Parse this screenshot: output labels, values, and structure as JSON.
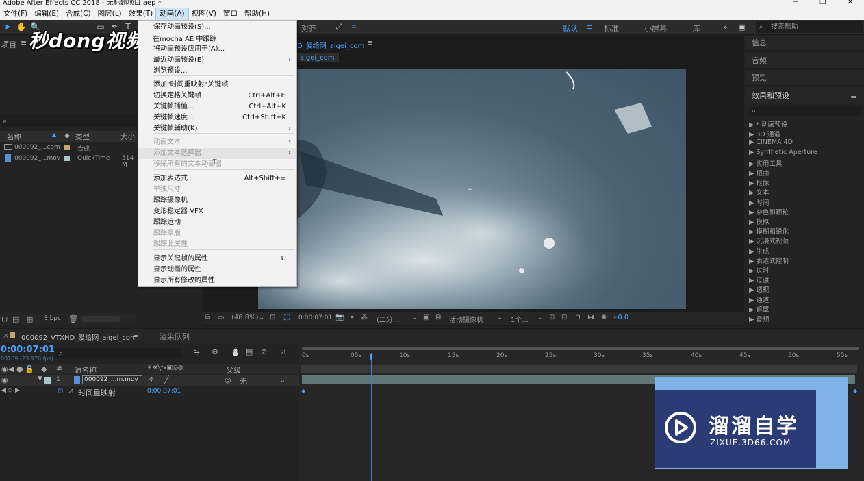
{
  "title": "Adobe After Effects CC 2018 - 无标题项目.aep *",
  "menubar": [
    "文件(F)",
    "编辑(E)",
    "合成(C)",
    "图层(L)",
    "效果(T)",
    "动画(A)",
    "视图(V)",
    "窗口",
    "帮助(H)"
  ],
  "menubar_active": "动画(A)",
  "toolbar": {
    "align_label": "对齐",
    "workspaces": [
      "默认",
      "标准",
      "小屏幕",
      "库"
    ],
    "search_placeholder": "搜索帮助"
  },
  "project": {
    "tab": "项目",
    "columns": [
      "名称",
      "类型",
      "大小"
    ],
    "items": [
      {
        "name": "000092_...com",
        "type": "合成",
        "size": ""
      },
      {
        "name": "000092_...mov",
        "type": "QuickTime",
        "size": "514 M"
      }
    ],
    "bpc": "8 bpc"
  },
  "viewer": {
    "comp_tab": "D_爱给网_aigei_com",
    "comp_crumb": "aigei_com",
    "zoom": "(48.8%)",
    "timecode": "0:00:07:01",
    "resolution": "(二分...",
    "camera": "活动摄像机",
    "views": "1个...",
    "exposure": "+0.0"
  },
  "dropdown": [
    {
      "label": "保存动画预设(S)...",
      "key": "",
      "arrow": false,
      "disabled": false
    },
    {
      "label": "将动画预设应用于(A)...",
      "key": "",
      "arrow": false,
      "disabled": false
    },
    {
      "label": "最近动画预设(E)",
      "key": "",
      "arrow": true,
      "disabled": false
    },
    {
      "label": "浏览预设...",
      "key": "",
      "arrow": false,
      "disabled": false
    },
    {
      "label": "添加\"时间重映射\"关键帧",
      "key": "",
      "arrow": false,
      "disabled": false
    },
    {
      "label": "切换定格关键帧",
      "key": "Ctrl+Alt+H",
      "arrow": false,
      "disabled": false
    },
    {
      "label": "关键帧插值...",
      "key": "Ctrl+Alt+K",
      "arrow": false,
      "disabled": false
    },
    {
      "label": "关键帧速度...",
      "key": "Ctrl+Shift+K",
      "arrow": false,
      "disabled": false
    },
    {
      "label": "关键帧辅助(K)",
      "key": "",
      "arrow": true,
      "disabled": false
    },
    {
      "label": "动画文本",
      "key": "",
      "arrow": true,
      "disabled": true
    },
    {
      "label": "添加文本选择器",
      "key": "",
      "arrow": true,
      "disabled": true
    },
    {
      "label": "移除所有的文本动画器",
      "key": "",
      "arrow": false,
      "disabled": true
    },
    {
      "label": "添加表达式",
      "key": "Alt+Shift+=",
      "arrow": false,
      "disabled": false
    },
    {
      "label": "单独尺寸",
      "key": "",
      "arrow": false,
      "disabled": true
    },
    {
      "label": "跟踪摄像机",
      "key": "",
      "arrow": false,
      "disabled": false
    },
    {
      "label": "变形稳定器 VFX",
      "key": "",
      "arrow": false,
      "disabled": false
    },
    {
      "label": "跟踪运动",
      "key": "",
      "arrow": false,
      "disabled": false
    },
    {
      "label": "跟踪蒙版",
      "key": "",
      "arrow": false,
      "disabled": true
    },
    {
      "label": "跟踪此属性",
      "key": "",
      "arrow": false,
      "disabled": true
    },
    {
      "label": "显示关键帧的属性",
      "key": "U",
      "arrow": false,
      "disabled": false
    },
    {
      "label": "显示动画的属性",
      "key": "",
      "arrow": false,
      "disabled": false
    },
    {
      "label": "显示所有修改的属性",
      "key": "",
      "arrow": false,
      "disabled": false
    }
  ],
  "dropdown_partial": "在mocha AE 中跟踪",
  "right_panel": {
    "sections": [
      "信息",
      "音频",
      "预览",
      "效果和预设"
    ],
    "effects": [
      "* 动画预设",
      "3D 通道",
      "CINEMA 4D",
      "Synthetic Aperture",
      "实用工具",
      "扭曲",
      "抠像",
      "文本",
      "时间",
      "杂色和颗粒",
      "模拟",
      "模糊和锐化",
      "沉浸式视频",
      "生成",
      "表达式控制",
      "过时",
      "过渡",
      "透视",
      "通道",
      "遮罩",
      "音频"
    ]
  },
  "timeline": {
    "tab": "000092_VTXHD_爱给网_aigei_com",
    "render_tab": "渲染队列",
    "current_time": "0:00:07:01",
    "fps": "00169 (23.976 fps)",
    "ruler": [
      "0s",
      "05s",
      "10s",
      "15s",
      "20s",
      "25s",
      "30s",
      "35s",
      "40s",
      "45s",
      "50s",
      "55s"
    ],
    "col_source": "源名称",
    "col_parent": "父级",
    "layer_num": "1",
    "layer_name": "000092_...m.mov",
    "parent_value": "无",
    "prop_name": "时间重映射",
    "prop_value": "0:00:07:01"
  },
  "watermarks": {
    "top_left": "秒dong视频",
    "bottom_right_title": "溜溜自学",
    "bottom_right_url": "ZIXUE.3D66.COM"
  }
}
